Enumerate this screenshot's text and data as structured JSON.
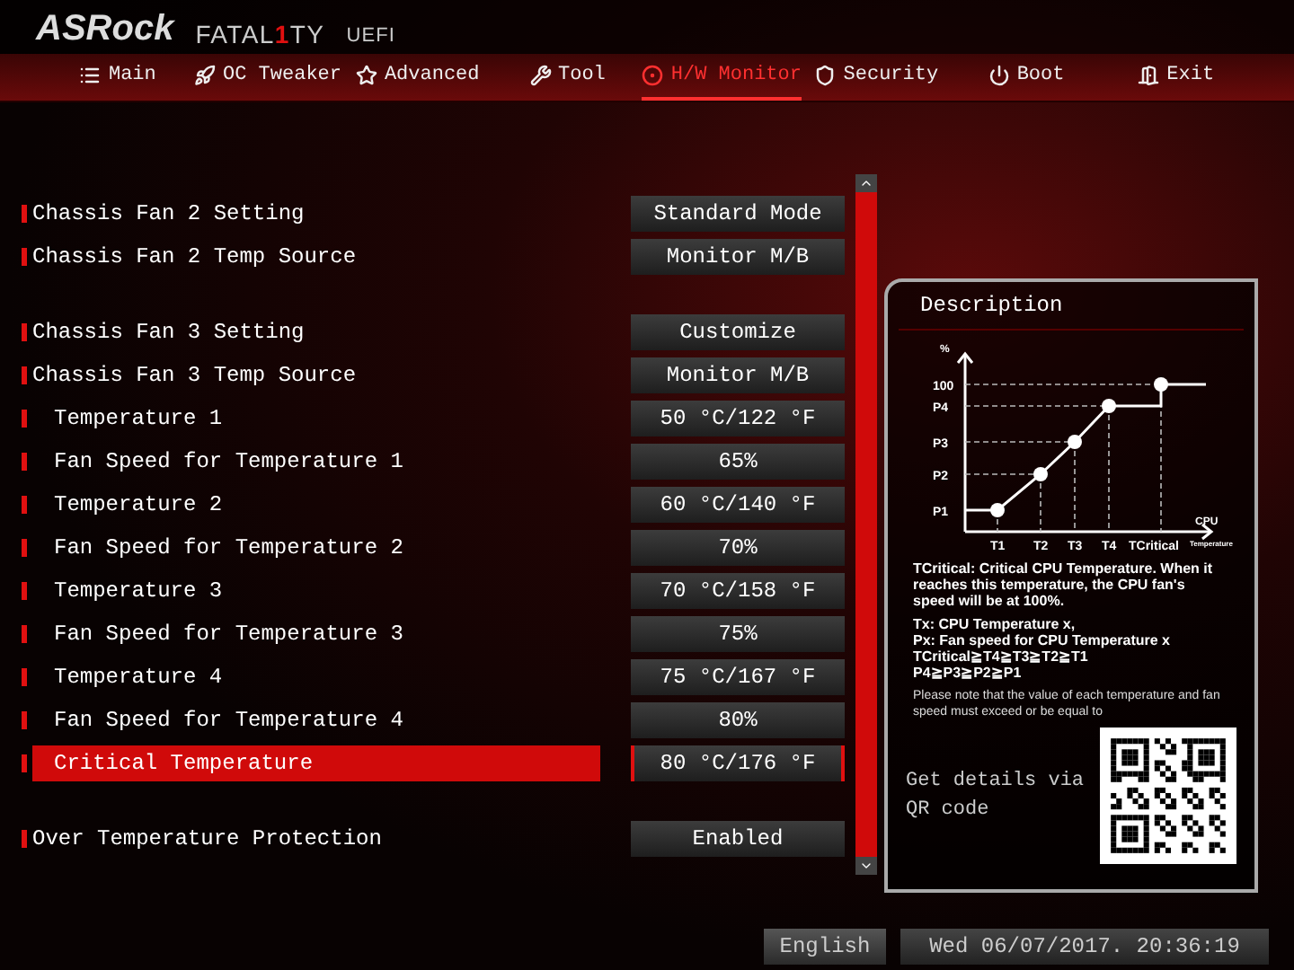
{
  "header": {
    "brand": "ASRock",
    "product_left": "FATAL",
    "product_mark": "1",
    "product_right": "TY",
    "suffix": "UEFI"
  },
  "tabs": [
    {
      "label": "Main",
      "selected": false
    },
    {
      "label": "OC Tweaker",
      "selected": false
    },
    {
      "label": "Advanced",
      "selected": false
    },
    {
      "label": "Tool",
      "selected": false
    },
    {
      "label": "H/W Monitor",
      "selected": true
    },
    {
      "label": "Security",
      "selected": false
    },
    {
      "label": "Boot",
      "selected": false
    },
    {
      "label": "Exit",
      "selected": false
    }
  ],
  "settings": [
    [
      {
        "label": "Chassis Fan 2 Setting",
        "value": "Standard Mode",
        "kind": "main",
        "selected": false
      },
      {
        "label": "Chassis Fan 2 Temp Source",
        "value": "Monitor M/B",
        "kind": "main",
        "selected": false
      }
    ],
    [
      {
        "label": "Chassis Fan 3 Setting",
        "value": "Customize",
        "kind": "main",
        "selected": false
      },
      {
        "label": "Chassis Fan 3 Temp Source",
        "value": "Monitor M/B",
        "kind": "main",
        "selected": false
      },
      {
        "label": "Temperature 1",
        "value": "50 °C/122 °F",
        "kind": "sub",
        "selected": false
      },
      {
        "label": "Fan Speed for Temperature 1",
        "value": "65%",
        "kind": "sub",
        "selected": false
      },
      {
        "label": "Temperature 2",
        "value": "60 °C/140 °F",
        "kind": "sub",
        "selected": false
      },
      {
        "label": "Fan Speed for Temperature 2",
        "value": "70%",
        "kind": "sub",
        "selected": false
      },
      {
        "label": "Temperature 3",
        "value": "70 °C/158 °F",
        "kind": "sub",
        "selected": false
      },
      {
        "label": "Fan Speed for Temperature 3",
        "value": "75%",
        "kind": "sub",
        "selected": false
      },
      {
        "label": "Temperature 4",
        "value": "75 °C/167 °F",
        "kind": "sub",
        "selected": false
      },
      {
        "label": "Fan Speed for Temperature 4",
        "value": "80%",
        "kind": "sub",
        "selected": false
      },
      {
        "label": "Critical Temperature",
        "value": "80 °C/176 °F",
        "kind": "sub",
        "selected": true
      }
    ],
    [
      {
        "label": "Over Temperature Protection",
        "value": "Enabled",
        "kind": "main",
        "selected": false
      }
    ]
  ],
  "description": {
    "title": "Description",
    "diagram": {
      "y_unit": "%",
      "y_labels": [
        "100",
        "P4",
        "P3",
        "P2",
        "P1"
      ],
      "x_labels": [
        "T1",
        "T2",
        "T3",
        "T4",
        "TCritical"
      ],
      "x_caption": "CPU",
      "x_subcaption": "Temperature"
    },
    "paragraphs": [
      "TCritical: Critical CPU Temperature. When it reaches this temperature, the CPU fan's speed will be at 100%.",
      "Tx: CPU Temperature x,\nPx: Fan speed for CPU Temperature x\nTCritical≧T4≧T3≧T2≧T1\nP4≧P3≧P2≧P1"
    ],
    "note": "Please note that the value of each temperature and fan speed must exceed or be equal to",
    "qr_caption": "Get details via QR code"
  },
  "language_button": "English",
  "datetime": "Wed 06/07/2017. 20:36:19"
}
